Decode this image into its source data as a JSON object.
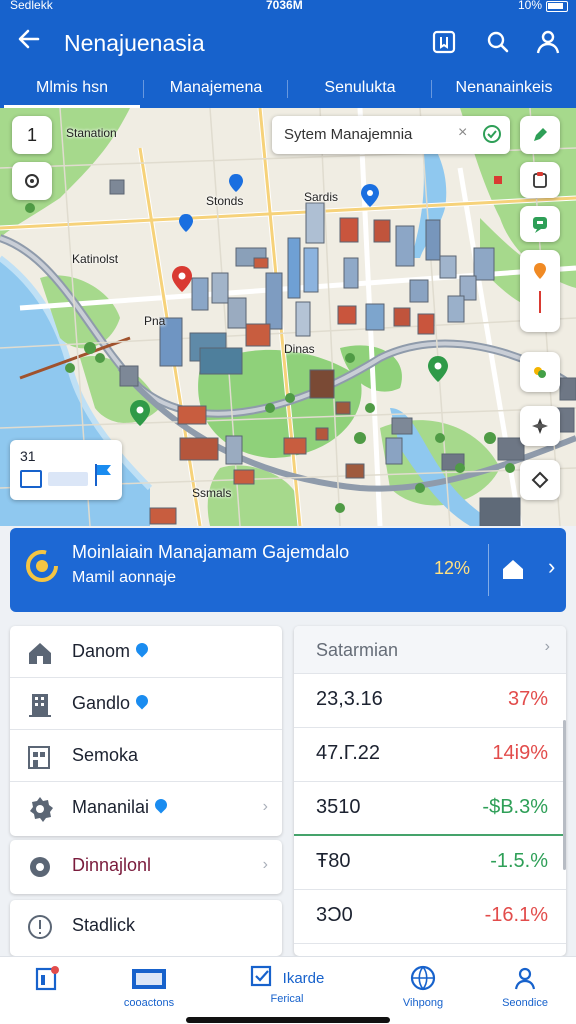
{
  "status_bar": {
    "carrier": "Sedlekk",
    "time": "7036M",
    "battery": "10%"
  },
  "app_bar": {
    "title": "Nenajuenasia"
  },
  "tabs": [
    {
      "label": "Mlmis hsn"
    },
    {
      "label": "Manajemena"
    },
    {
      "label": "Senulukta"
    },
    {
      "label": "Nenanainkeis"
    }
  ],
  "map": {
    "zoom_level": "1",
    "search_value": "Sytem Manajemnia",
    "labels": [
      "Stanation",
      "Stonds",
      "Sardis",
      "Katinolst",
      "Pna",
      "Dinas",
      "Ssmals"
    ],
    "legend_value": "31"
  },
  "banner": {
    "title": "Moinlaiain Manajamam Gajemdalo",
    "subtitle": "Mamil aonnaje",
    "percent": "12%"
  },
  "list": [
    {
      "label": "Danom",
      "icon": "home-icon",
      "pin": true,
      "chevron": false
    },
    {
      "label": "Gandlo",
      "icon": "building-icon",
      "pin": true,
      "chevron": false
    },
    {
      "label": "Semoka",
      "icon": "office-icon",
      "pin": false,
      "chevron": false
    },
    {
      "label": "Mananilai",
      "icon": "gear-icon",
      "pin": true,
      "chevron": true
    },
    {
      "label": "Dinnajlonl",
      "icon": "settings-icon",
      "pin": false,
      "chevron": true
    },
    {
      "label": "Stadlick",
      "icon": "alert-icon",
      "pin": false,
      "chevron": false
    }
  ],
  "stats": {
    "header": "Satarmian",
    "rows": [
      {
        "value": "23,3.16",
        "delta": "37%",
        "trend": "down"
      },
      {
        "value": "47.Г.22",
        "delta": "14i9%",
        "trend": "down"
      },
      {
        "value": "3510",
        "delta": "-$B.3%",
        "trend": "up"
      },
      {
        "value": "Ŧ80",
        "delta": "-1.5.%",
        "trend": "up"
      },
      {
        "value": "3Ɔ0",
        "delta": "-16.1%",
        "trend": "down"
      }
    ]
  },
  "bottom_nav": [
    {
      "label": "",
      "icon": "notes-icon"
    },
    {
      "label": "cooactons",
      "icon": "map-icon"
    },
    {
      "label": "Ferical",
      "icon": "checkbox-icon",
      "extra": "Ikarde"
    },
    {
      "label": "Vihpong",
      "icon": "globe-icon"
    },
    {
      "label": "Seondice",
      "icon": "profile-icon"
    }
  ],
  "colors": {
    "primary": "#1762cc",
    "negative": "#e24c4b",
    "positive": "#2e9f57",
    "park": "#8fd17a",
    "water": "#8fc8ef"
  }
}
